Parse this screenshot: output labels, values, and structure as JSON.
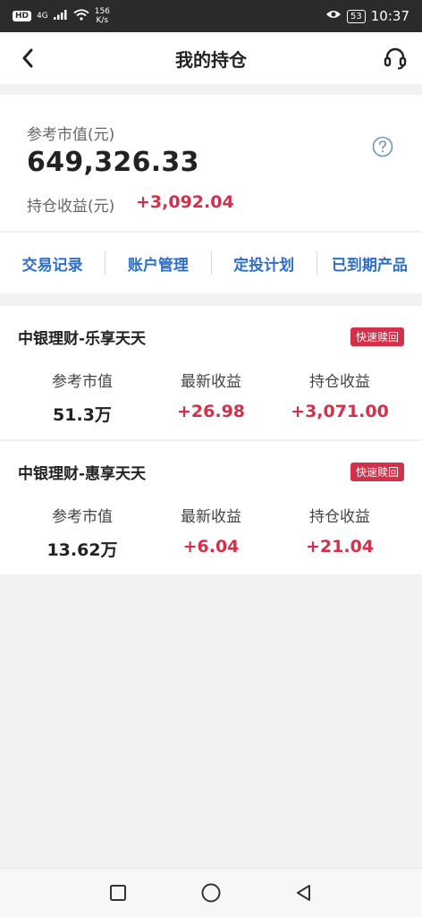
{
  "status_bar": {
    "hd": "HD",
    "network": "4G",
    "speed_value": "156",
    "speed_unit": "K/s",
    "battery": "53",
    "time": "10:37",
    "icons": [
      "signal-icon",
      "wifi-icon",
      "eye-icon",
      "battery-icon"
    ]
  },
  "header": {
    "title": "我的持仓",
    "back_icon": "chevron-left-icon",
    "support_icon": "headset-icon"
  },
  "summary": {
    "market_value_label": "参考市值(元)",
    "market_value": "649,326.33",
    "profit_label": "持仓收益(元)",
    "profit_value": "+3,092.04",
    "help_icon": "question-circle-icon"
  },
  "actions": [
    {
      "label": "交易记录"
    },
    {
      "label": "账户管理"
    },
    {
      "label": "定投计划"
    },
    {
      "label": "已到期产品"
    }
  ],
  "products": [
    {
      "name": "中银理财-乐享天天",
      "badge": "快速赎回",
      "metrics": [
        {
          "label": "参考市值",
          "value": "51.3万"
        },
        {
          "label": "最新收益",
          "value": "+26.98"
        },
        {
          "label": "持仓收益",
          "value": "+3,071.00"
        }
      ]
    },
    {
      "name": "中银理财-惠享天天",
      "badge": "快速赎回",
      "metrics": [
        {
          "label": "参考市值",
          "value": "13.62万"
        },
        {
          "label": "最新收益",
          "value": "+6.04"
        },
        {
          "label": "持仓收益",
          "value": "+21.04"
        }
      ]
    }
  ],
  "colors": {
    "accent_blue": "#2f6fca",
    "profit_red": "#d4304a",
    "status_bar": "#2b2b2b",
    "background": "#f2f2f2"
  },
  "system_nav": [
    "square-icon",
    "circle-icon",
    "triangle-back-icon"
  ]
}
